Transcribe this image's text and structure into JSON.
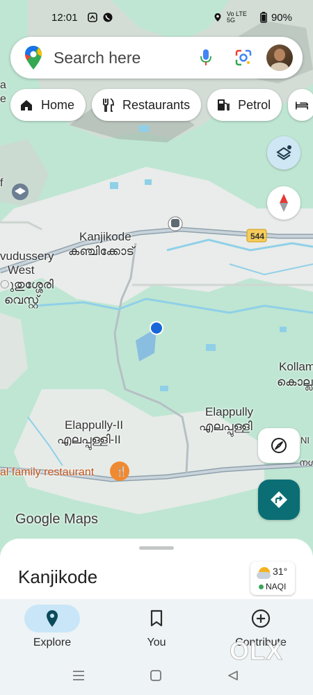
{
  "status_bar": {
    "time": "12:01",
    "network": "Vo LTE 5G",
    "battery": "90%"
  },
  "search": {
    "placeholder": "Search here",
    "icons": [
      "google-maps-pin-icon",
      "mic-icon",
      "google-lens-icon",
      "profile-avatar"
    ]
  },
  "chips": [
    {
      "label": "Home",
      "icon": "home-icon"
    },
    {
      "label": "Restaurants",
      "icon": "fork-knife-icon"
    },
    {
      "label": "Petrol",
      "icon": "fuel-pump-icon"
    }
  ],
  "map_labels": {
    "kanjikode_en": "Kanjikode",
    "kanjikode_ml": "കഞ്ചിക്കോട്",
    "pudussery_en": "vudussery",
    "west_en": "West",
    "pudussery_ml": "ുതുശ്ശേരി",
    "west_ml": "വെസ്റ്റ്",
    "kollam_en": "Kollam",
    "kollam_ml": "കൊല്ല",
    "elappully2_en": "Elappully-II",
    "elappully2_ml": "എലപ്പുള്ളി-II",
    "elappully_en": "Elappully",
    "elappully_ml": "എലപ്പുള്ളി",
    "restaurant": "al family restaurant",
    "highway": "544",
    "edge_a": "a",
    "edge_e": "e",
    "edge_f": "f",
    "edge_ni": "NI",
    "edge_ml": "നഗ"
  },
  "branding": {
    "logo": "Google Maps"
  },
  "sheet": {
    "place": "Kanjikode"
  },
  "weather": {
    "temp": "31°",
    "aqi": "NAQI"
  },
  "bottom_nav": [
    {
      "label": "Explore",
      "icon": "explore-pin-icon",
      "active": true
    },
    {
      "label": "You",
      "icon": "bookmark-icon",
      "active": false
    },
    {
      "label": "Contribute",
      "icon": "add-circle-icon",
      "active": false
    }
  ],
  "watermark": "OLX",
  "colors": {
    "accent": "#0b6e75",
    "active_tab": "#c8e6f8",
    "location_dot": "#1a66d8",
    "map_green": "#bfe6d3"
  }
}
